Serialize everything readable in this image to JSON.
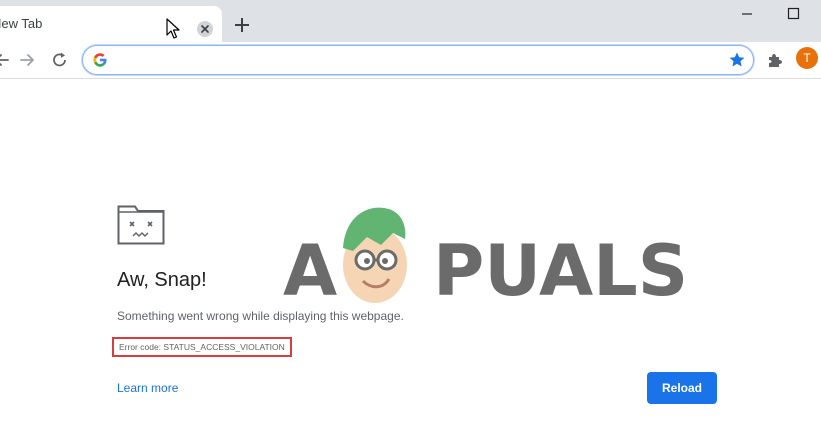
{
  "tab": {
    "title": "New Tab",
    "close_icon": "close-icon",
    "new_tab_icon": "plus-icon"
  },
  "window": {
    "minimize_icon": "minimize-icon",
    "maximize_icon": "maximize-icon"
  },
  "toolbar": {
    "back_icon": "back-arrow-icon",
    "forward_icon": "forward-arrow-icon",
    "reload_icon": "reload-icon",
    "omnibox_value": "",
    "search_engine_icon": "google-icon",
    "bookmark_icon": "star-icon",
    "extensions_icon": "puzzle-icon",
    "profile_initial": "T"
  },
  "error_page": {
    "icon": "sad-tab-icon",
    "title": "Aw, Snap!",
    "message": "Something went wrong while displaying this webpage.",
    "error_code": "Error code: STATUS_ACCESS_VIOLATION",
    "learn_more": "Learn more",
    "reload_label": "Reload"
  },
  "watermark": {
    "text_a": "A",
    "text_rest": "PUALS"
  },
  "colors": {
    "accent": "#1a73e8",
    "highlight_box": "#d93c3c",
    "avatar": "#e8710a",
    "tabstrip": "#dee1e6"
  }
}
